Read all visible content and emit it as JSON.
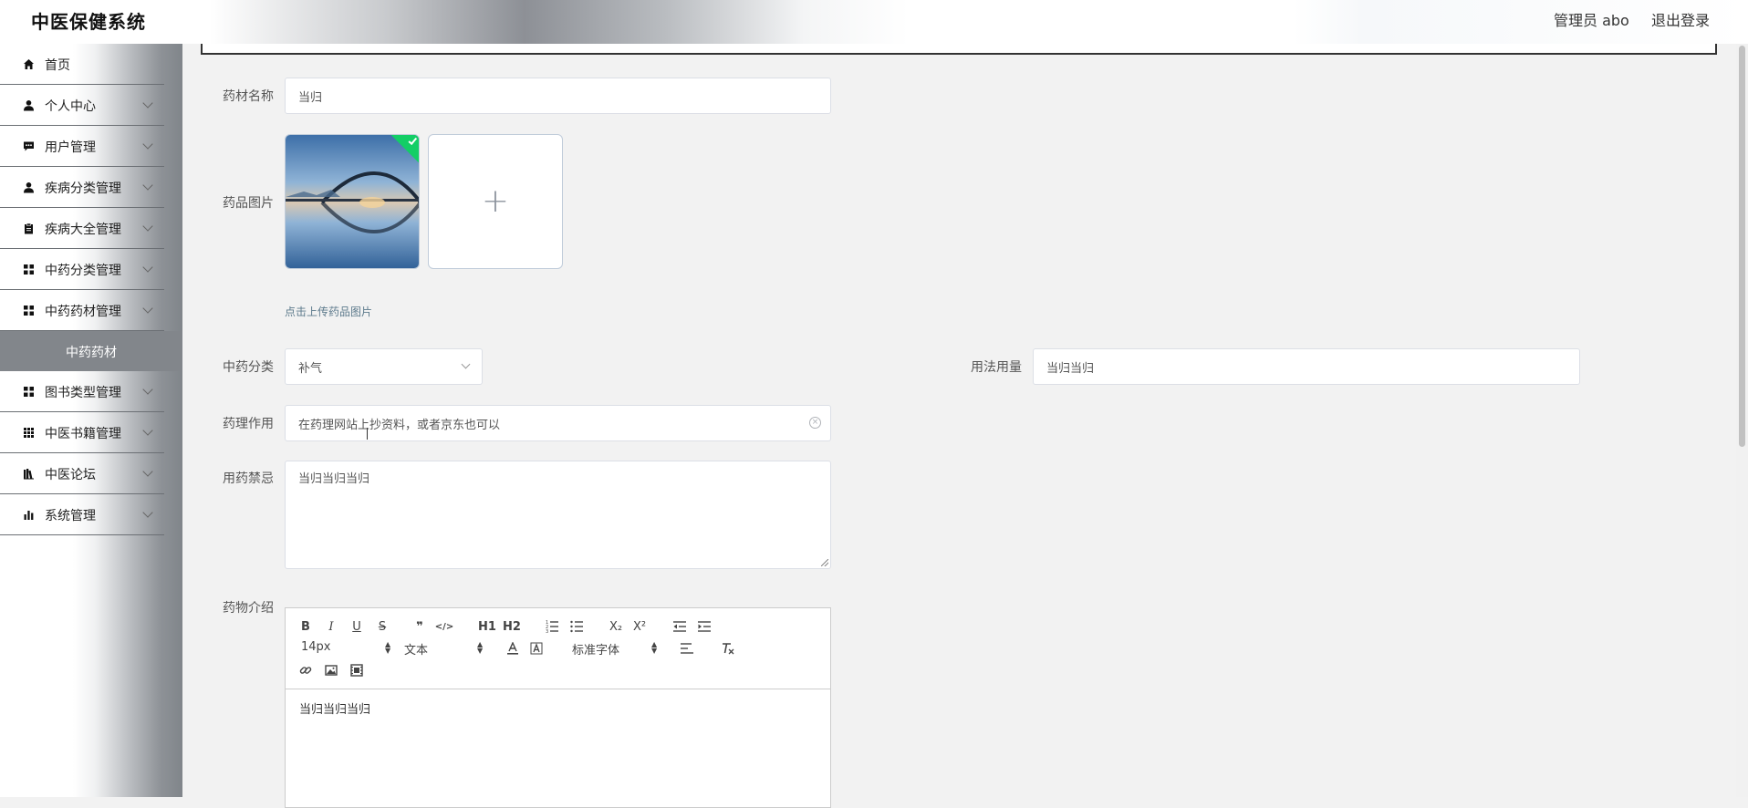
{
  "header": {
    "title": "中医保健系统",
    "user": "管理员 abo",
    "logout": "退出登录"
  },
  "sidebar": {
    "items": [
      {
        "label": "首页",
        "icon": "home-icon"
      },
      {
        "label": "个人中心",
        "icon": "user-icon"
      },
      {
        "label": "用户管理",
        "icon": "chat-icon"
      },
      {
        "label": "疾病分类管理",
        "icon": "user-icon"
      },
      {
        "label": "疾病大全管理",
        "icon": "clipboard-icon"
      },
      {
        "label": "中药分类管理",
        "icon": "grid-icon"
      },
      {
        "label": "中药药材管理",
        "icon": "grid-icon"
      },
      {
        "label": "图书类型管理",
        "icon": "grid-icon"
      },
      {
        "label": "中医书籍管理",
        "icon": "apps-icon"
      },
      {
        "label": "中医论坛",
        "icon": "bookshelf-icon"
      },
      {
        "label": "系统管理",
        "icon": "bar-chart-icon"
      }
    ],
    "active_sub": "中药药材"
  },
  "form": {
    "name_label": "药材名称",
    "name_value": "当归",
    "image_label": "药品图片",
    "upload_tip": "点击上传药品图片",
    "category_label": "中药分类",
    "category_value": "补气",
    "usage_label": "用法用量",
    "usage_value": "当归当归",
    "effect_label": "药理作用",
    "effect_value": "在药理网站上抄资料，或者京东也可以",
    "contra_label": "用药禁忌",
    "contra_value": "当归当归当归",
    "intro_label": "药物介绍",
    "intro_value": "当归当归当归"
  },
  "editor": {
    "font_size": "14px",
    "header_select": "文本",
    "font_family": "标准字体",
    "buttons": [
      "B",
      "I",
      "U",
      "S",
      "❞",
      "</>",
      "H1",
      "H2",
      "ordered-list",
      "bullet-list",
      "X₂",
      "X²",
      "outdent",
      "indent"
    ]
  },
  "colors": {
    "accent": "#13ce66",
    "active_menu": "#82868b"
  }
}
